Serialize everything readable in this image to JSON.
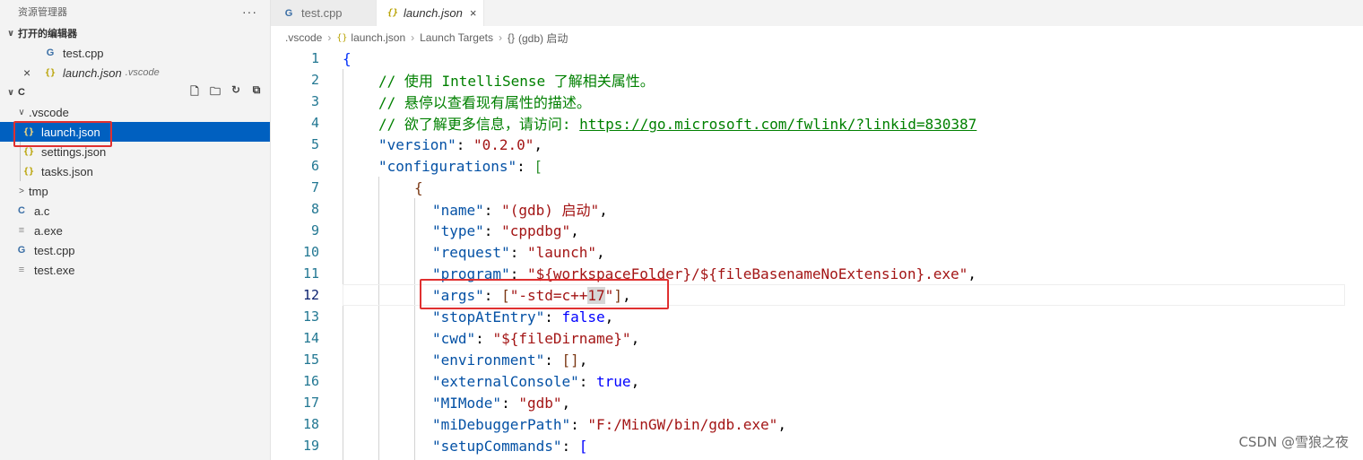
{
  "sidebar": {
    "title": "资源管理器",
    "more": "···",
    "open_editors_label": "打开的编辑器",
    "open_editors": [
      {
        "icon": "G",
        "name": "test.cpp",
        "hint": ""
      },
      {
        "icon": "{}",
        "name": "launch.json",
        "hint": ".vscode"
      }
    ],
    "folder_label": "C",
    "actions": [
      "new-file",
      "new-folder",
      "refresh",
      "collapse-all"
    ],
    "tree": [
      {
        "chev": "∨",
        "name": ".vscode"
      },
      {
        "icon": "{}",
        "name": "launch.json"
      },
      {
        "icon": "{}",
        "name": "settings.json"
      },
      {
        "icon": "{}",
        "name": "tasks.json"
      },
      {
        "chev": ">",
        "name": "tmp"
      },
      {
        "icon": "C",
        "name": "a.c"
      },
      {
        "icon": "≡",
        "name": "a.exe"
      },
      {
        "icon": "G",
        "name": "test.cpp"
      },
      {
        "icon": "≡",
        "name": "test.exe"
      }
    ]
  },
  "tabs": [
    {
      "icon": "G",
      "label": "test.cpp"
    },
    {
      "icon": "{}",
      "label": "launch.json",
      "close": "×"
    }
  ],
  "breadcrumb": [
    ".vscode",
    "launch.json",
    "Launch Targets",
    "(gdb) 启动"
  ],
  "breadcrumb_icon": "{}",
  "editor": {
    "line_numbers": [
      "1",
      "2",
      "3",
      "4",
      "5",
      "6",
      "7",
      "8",
      "9",
      "10",
      "11",
      "12",
      "13",
      "14",
      "15",
      "16",
      "17",
      "18",
      "19"
    ],
    "current_line": "12",
    "lines": {
      "l1": "{",
      "l2": "// 使用 IntelliSense 了解相关属性。",
      "l3": "// 悬停以查看现有属性的描述。",
      "l4_comment": "// 欲了解更多信息，请访问: ",
      "l4_link": "https://go.microsoft.com/fwlink/?linkid=830387",
      "l5_key": "\"version\"",
      "l5_val": "\"0.2.0\"",
      "l6_key": "\"configurations\"",
      "l7": "{",
      "l8_key": "\"name\"",
      "l8_val": "\"(gdb) 启动\"",
      "l9_key": "\"type\"",
      "l9_val": "\"cppdbg\"",
      "l10_key": "\"request\"",
      "l10_val": "\"launch\"",
      "l11_key": "\"program\"",
      "l11_val": "\"${workspaceFolder}/${fileBasenameNoExtension}.exe\"",
      "l12_key": "\"args\"",
      "l12_val_a": "\"-std=c++",
      "l12_val_sel": "17",
      "l12_val_b": "\"",
      "l13_key": "\"stopAtEntry\"",
      "l13_val": "false",
      "l14_key": "\"cwd\"",
      "l14_val": "\"${fileDirname}\"",
      "l15_key": "\"environment\"",
      "l15_val": "[]",
      "l16_key": "\"externalConsole\"",
      "l16_val": "true",
      "l17_key": "\"MIMode\"",
      "l17_val": "\"gdb\"",
      "l18_key": "\"miDebuggerPath\"",
      "l18_val": "\"F:/MinGW/bin/gdb.exe\"",
      "l19_key": "\"setupCommands\""
    }
  },
  "watermark": "CSDN @雪狼之夜"
}
